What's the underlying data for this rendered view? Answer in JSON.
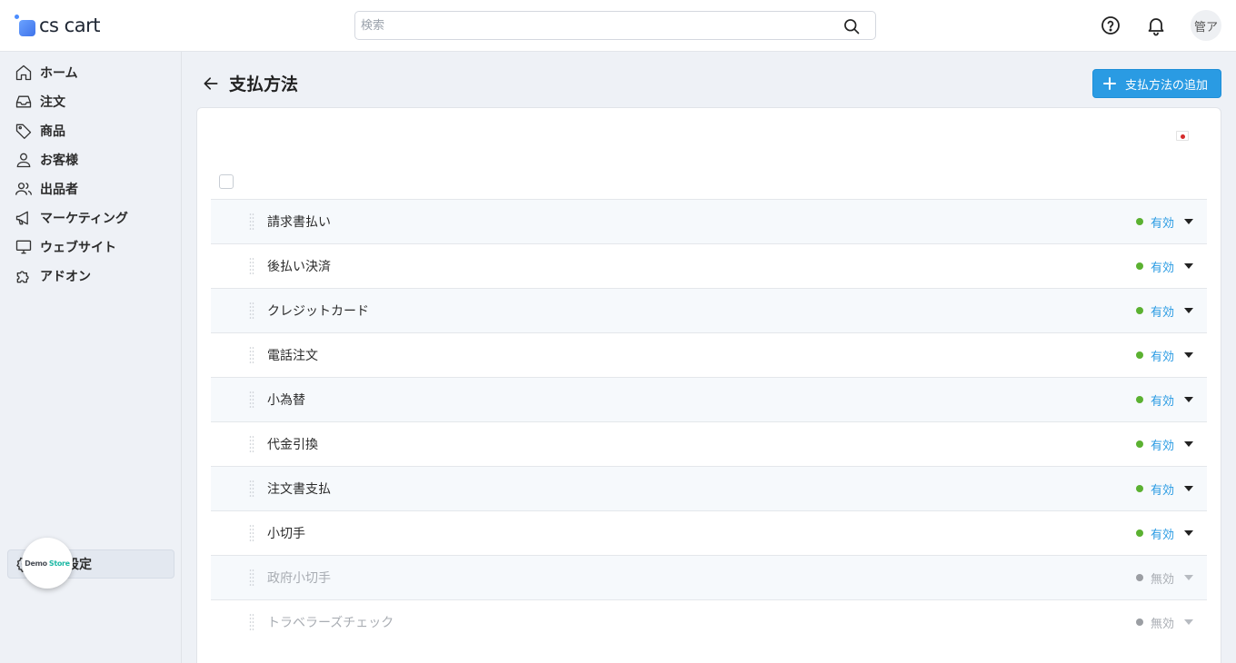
{
  "app": {
    "logo_text": "cs cart",
    "search_placeholder": "検索",
    "user_initials": "管ア"
  },
  "sidebar": {
    "items": [
      {
        "label": "ホーム",
        "icon": "home-icon"
      },
      {
        "label": "注文",
        "icon": "inbox-icon"
      },
      {
        "label": "商品",
        "icon": "tag-icon"
      },
      {
        "label": "お客様",
        "icon": "user-icon"
      },
      {
        "label": "出品者",
        "icon": "users-icon"
      },
      {
        "label": "マーケティング",
        "icon": "megaphone-icon"
      },
      {
        "label": "ウェブサイト",
        "icon": "monitor-icon"
      },
      {
        "label": "アドオン",
        "icon": "puzzle-icon"
      }
    ],
    "settings": {
      "label": "基本設定",
      "icon": "gear-icon"
    },
    "store_badge": {
      "part1": "Demo",
      "part2": "Store"
    }
  },
  "page": {
    "title": "支払方法",
    "add_button_label": "支払方法の追加",
    "language_flag": "japan-flag-icon"
  },
  "payment_methods": [
    {
      "name": "請求書払い",
      "status": "有効",
      "enabled": true
    },
    {
      "name": "後払い決済",
      "status": "有効",
      "enabled": true
    },
    {
      "name": "クレジットカード",
      "status": "有効",
      "enabled": true
    },
    {
      "name": "電話注文",
      "status": "有効",
      "enabled": true
    },
    {
      "name": "小為替",
      "status": "有効",
      "enabled": true
    },
    {
      "name": "代金引換",
      "status": "有効",
      "enabled": true
    },
    {
      "name": "注文書支払",
      "status": "有効",
      "enabled": true
    },
    {
      "name": "小切手",
      "status": "有効",
      "enabled": true
    },
    {
      "name": "政府小切手",
      "status": "無効",
      "enabled": false
    },
    {
      "name": "トラベラーズチェック",
      "status": "無効",
      "enabled": false
    }
  ],
  "colors": {
    "accent": "#2a9be3",
    "enabled_dot": "#5bb131",
    "disabled_dot": "#9b9ea3",
    "disabled_text": "#a9adb3"
  }
}
